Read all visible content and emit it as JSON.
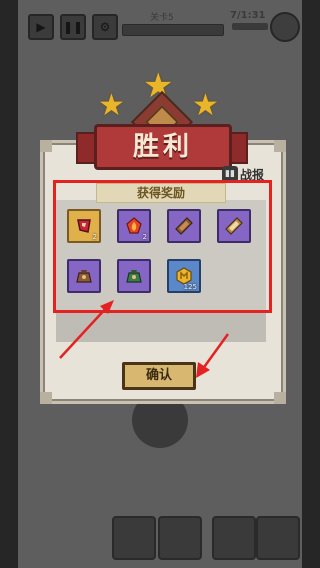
{
  "hud": {
    "stage_label": "关卡5",
    "counter": "7/1:31"
  },
  "dialog": {
    "title": "胜利",
    "stars_earned": 3,
    "stats_label": "战报",
    "rewards_header": "获得奖励",
    "confirm_label": "确认"
  },
  "rewards": [
    {
      "name": "rune-scroll",
      "rarity": "gold",
      "qty": "2"
    },
    {
      "name": "fire-gem",
      "rarity": "purple",
      "qty": "2"
    },
    {
      "name": "brown-crystal",
      "rarity": "purple",
      "qty": ""
    },
    {
      "name": "amber-crystal",
      "rarity": "purple",
      "qty": ""
    },
    {
      "name": "loot-bag-brown",
      "rarity": "purple",
      "qty": ""
    },
    {
      "name": "loot-bag-green",
      "rarity": "purple",
      "qty": ""
    },
    {
      "name": "gold-coin",
      "rarity": "blue",
      "qty": "125"
    }
  ],
  "colors": {
    "highlight": "#e52222",
    "star": "#e8b52b",
    "banner": "#b0393a"
  }
}
